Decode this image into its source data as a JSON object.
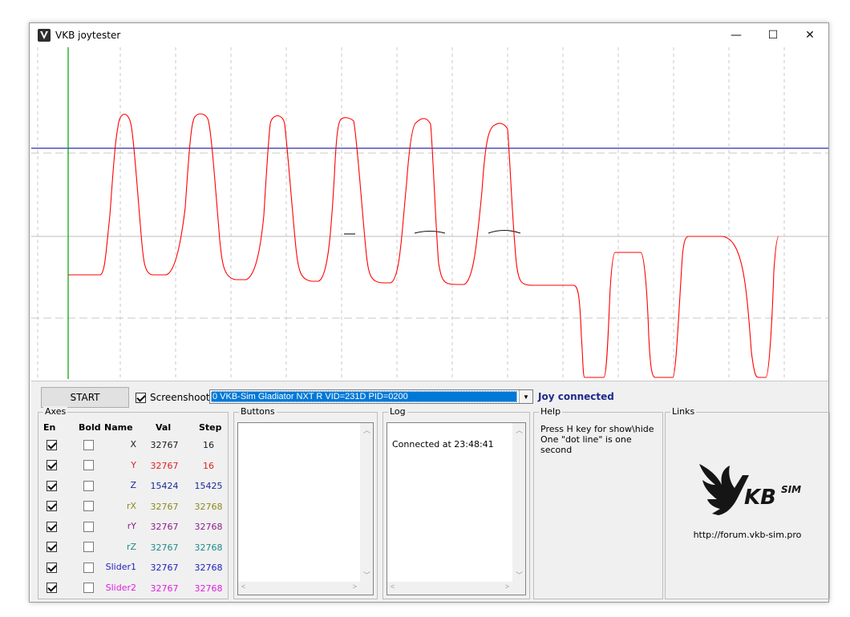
{
  "window": {
    "title": "VKB joytester",
    "controls": {
      "minimize": "—",
      "maximize": "☐",
      "close": "✕"
    }
  },
  "toolbar": {
    "start_label": "START",
    "screenshoot_label": "Screenshoot",
    "screenshoot_checked": true,
    "device_selected": "0  VKB-Sim Gladiator NXT R   VID=231D PID=0200",
    "status": "Joy connected"
  },
  "axes": {
    "title": "Axes",
    "headers": {
      "en": "En",
      "bold": "Bold",
      "name": "Name",
      "val": "Val",
      "step": "Step"
    },
    "rows": [
      {
        "name": "X",
        "val": "32767",
        "step": "16",
        "color": "#1a1a1a",
        "enabled": true,
        "bold": false
      },
      {
        "name": "Y",
        "val": "32767",
        "step": "16",
        "color": "#e02020",
        "enabled": true,
        "bold": false
      },
      {
        "name": "Z",
        "val": "15424",
        "step": "15425",
        "color": "#1a2a9a",
        "enabled": true,
        "bold": false
      },
      {
        "name": "rX",
        "val": "32767",
        "step": "32768",
        "color": "#8a8a20",
        "enabled": true,
        "bold": false
      },
      {
        "name": "rY",
        "val": "32767",
        "step": "32768",
        "color": "#8a208a",
        "enabled": true,
        "bold": false
      },
      {
        "name": "rZ",
        "val": "32767",
        "step": "32768",
        "color": "#208a8a",
        "enabled": true,
        "bold": false
      },
      {
        "name": "Slider1",
        "val": "32767",
        "step": "32768",
        "color": "#2020c0",
        "enabled": true,
        "bold": false
      },
      {
        "name": "Slider2",
        "val": "32767",
        "step": "32768",
        "color": "#e020e0",
        "enabled": true,
        "bold": false
      }
    ]
  },
  "buttons": {
    "title": "Buttons"
  },
  "log": {
    "title": "Log",
    "lines": [
      "Connected at 23:48:41"
    ]
  },
  "help": {
    "title": "Help",
    "line1": "Press H key for show\\hide",
    "line2": "One \"dot line\" is one second"
  },
  "links": {
    "title": "Links",
    "logo_text": "KBSIM",
    "url": "http://forum.vkb-sim.pro"
  },
  "colors": {
    "y_trace": "#ff0000",
    "z_line": "#2b2bb0",
    "cursor": "#00a000",
    "accent": "#0078d7"
  }
}
